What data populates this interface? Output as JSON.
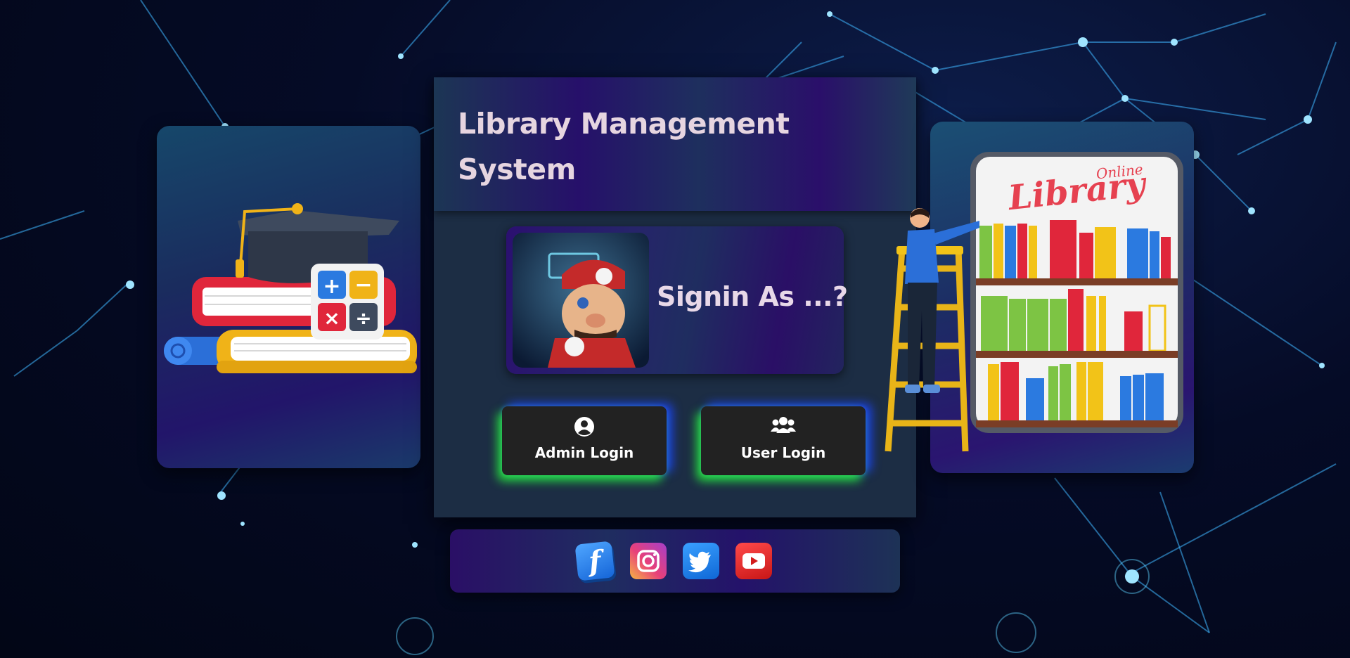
{
  "app": {
    "title": "Library Management System"
  },
  "signin": {
    "prompt": "Signin As ...?"
  },
  "buttons": {
    "admin_label": "Admin Login",
    "user_label": "User Login"
  },
  "illustrations": {
    "left": "graduation-books-icon",
    "right": "online-library-icon",
    "right_sign_text": "Online Library",
    "avatar": "mario-avatar"
  },
  "social": [
    {
      "name": "facebook-icon",
      "glyph": "f"
    },
    {
      "name": "instagram-icon"
    },
    {
      "name": "twitter-icon"
    },
    {
      "name": "youtube-icon"
    }
  ],
  "colors": {
    "background": "#050b26",
    "card": "#1c2d44",
    "title_text": "#e6d5e0",
    "button_bg": "#222222",
    "glow_green": "#28ff3c",
    "glow_blue": "#1e46ff"
  }
}
